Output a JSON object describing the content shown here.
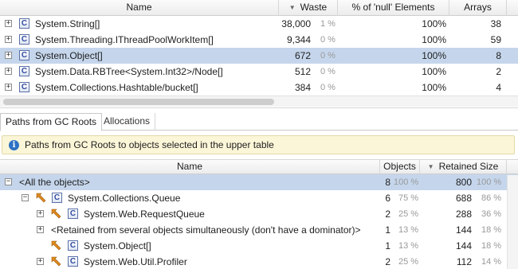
{
  "upper_table": {
    "columns": {
      "name": "Name",
      "waste": "Waste",
      "null_pct": "% of 'null' Elements",
      "arrays": "Arrays"
    },
    "rows": [
      {
        "name": "System.String[]",
        "waste": "38,000",
        "waste_pct": "1 %",
        "null_pct": "100%",
        "arrays": "38",
        "selected": false
      },
      {
        "name": "System.Threading.IThreadPoolWorkItem[]",
        "waste": "9,344",
        "waste_pct": "0 %",
        "null_pct": "100%",
        "arrays": "59",
        "selected": false
      },
      {
        "name": "System.Object[]",
        "waste": "672",
        "waste_pct": "0 %",
        "null_pct": "100%",
        "arrays": "8",
        "selected": true
      },
      {
        "name": "System.Data.RBTree<System.Int32>/Node[]",
        "waste": "512",
        "waste_pct": "0 %",
        "null_pct": "100%",
        "arrays": "2",
        "selected": false
      },
      {
        "name": "System.Collections.Hashtable/bucket[]",
        "waste": "384",
        "waste_pct": "0 %",
        "null_pct": "100%",
        "arrays": "4",
        "selected": false
      }
    ]
  },
  "tabs": [
    {
      "label": "Paths from GC Roots",
      "active": true
    },
    {
      "label": "Allocations",
      "active": false
    }
  ],
  "info_bar": {
    "text": "Paths from GC Roots to objects selected in the upper table"
  },
  "lower_table": {
    "columns": {
      "name": "Name",
      "objects": "Objects",
      "retained": "Retained Size"
    },
    "rows": [
      {
        "name": "<All the objects>",
        "objects": "8",
        "objects_pct": "100 %",
        "retained": "800",
        "retained_pct": "100 %"
      },
      {
        "name": "System.Collections.Queue",
        "objects": "6",
        "objects_pct": "75 %",
        "retained": "688",
        "retained_pct": "86 %"
      },
      {
        "name": "System.Web.RequestQueue",
        "objects": "2",
        "objects_pct": "25 %",
        "retained": "288",
        "retained_pct": "36 %"
      },
      {
        "name": "<Retained from several objects simultaneously (don't have a dominator)>",
        "objects": "1",
        "objects_pct": "13 %",
        "retained": "144",
        "retained_pct": "18 %"
      },
      {
        "name": "System.Object[]",
        "objects": "1",
        "objects_pct": "13 %",
        "retained": "144",
        "retained_pct": "18 %"
      },
      {
        "name": "System.Web.Util.Profiler",
        "objects": "2",
        "objects_pct": "25 %",
        "retained": "112",
        "retained_pct": "14 %"
      }
    ]
  },
  "icons": {
    "expand": "+",
    "collapse": "−",
    "class_letter": "C",
    "info_letter": "i",
    "sort_desc": "▼"
  },
  "colors": {
    "selection": "#c5d6ec",
    "info_bg": "#fcf6d8",
    "class_icon": "#2f4aa0",
    "gc_icon": "#e08a1e"
  }
}
